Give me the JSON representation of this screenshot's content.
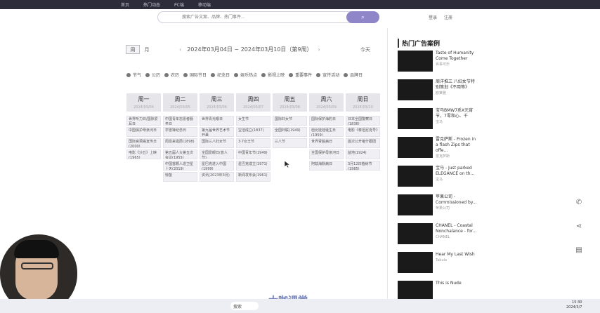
{
  "top_nav": [
    "首页",
    "热门动态",
    "PC端",
    "移动端"
  ],
  "search": {
    "placeholder": "搜索广告文案、品牌、热门事件...",
    "button": "⌕"
  },
  "auth": {
    "login": "登录",
    "register": "注册"
  },
  "view": {
    "week": "周",
    "month": "月"
  },
  "week_title": "2024年03月04日 ~ 2024年03月10日（第9周）",
  "today": "今天",
  "legend": [
    "节气",
    "公历",
    "农历",
    "国际节日",
    "纪念日",
    "娱乐热点",
    "影视上映",
    "重要事件",
    "宣传活动",
    "品牌日"
  ],
  "days": [
    {
      "w": "周一",
      "d": "2024/03/04",
      "events": [
        "世界听力日/国际爱耳日",
        "中国保护母亲河日",
        "国际宫颈癌宣传日(2000)",
        "电影《沙丘》上映(1965)"
      ]
    },
    {
      "w": "周二",
      "d": "2024/03/05",
      "events": [
        "中国青年志愿者服务日",
        "学雷锋纪念日",
        "周恩来诞辰(1898)",
        "第五届人大第五次会议(1955)",
        "中国首颗人造卫星上天(2019)",
        "惊蛰"
      ]
    },
    {
      "w": "周三",
      "d": "2024/03/06",
      "events": [
        "世界青光眼日",
        "第九届世界艺术节开幕",
        "国际三八妇女节",
        "全国爱眼日(盲人节)",
        "星巴克进入中国(1999)",
        "资讯(2023年3月)"
      ]
    },
    {
      "w": "周四",
      "d": "2024/03/07",
      "events": [
        "女生节",
        "宝洁成立(1837)",
        "3·7女王节",
        "中国青年节(1949)",
        "星巴克成立(1971)",
        "新闻发布会(1961)"
      ]
    },
    {
      "w": "周五",
      "d": "2024/03/08",
      "events": [
        "国际妇女节",
        "全国妇联(1949)",
        "三八节"
      ]
    },
    {
      "w": "周六",
      "d": "2024/03/09",
      "events": [
        "国际保护海豹日",
        "芭比娃娃诞生日(1959)",
        "世界肾脏病日",
        "全国保护母亲河日",
        "阿兹海默病日"
      ]
    },
    {
      "w": "周日",
      "d": "2024/03/10",
      "events": [
        "日本全国警察日(1836)",
        "电影《泰坦尼克号》",
        "首次公开喀什跟团",
        "盆地(1924)",
        "3月12日植树节(1985)"
      ]
    }
  ],
  "hot": {
    "title": "热门广告案例",
    "items": [
      {
        "t": "Taste of Humanity\nCome Together",
        "s": "百事可乐"
      },
      {
        "t": "周洋推三 八妇女节特别策划《不用等》",
        "s": "欧莱雅"
      },
      {
        "t": "宝马BMW7系X元宵节，7零和心、千",
        "s": "宝马"
      },
      {
        "t": "雷克萨斯 - Frozen in a flash Zips that offe...",
        "s": "雷克萨斯"
      },
      {
        "t": "宝马 - Just parked ELEGANCE on th...",
        "s": "宝马"
      },
      {
        "t": "苹果公司 - Commissioned by...",
        "s": "苹果公司"
      },
      {
        "t": "CHANEL - Coastal Nonchalance - for...",
        "s": "CHANEL"
      },
      {
        "t": "Hear My Last Wish",
        "s": "Tabula"
      },
      {
        "t": "This is Nude",
        "s": ""
      }
    ]
  },
  "taskbar": {
    "search": "搜索",
    "time": "15:30",
    "date": "2024/3/7"
  },
  "watermark": "大咖课堂"
}
